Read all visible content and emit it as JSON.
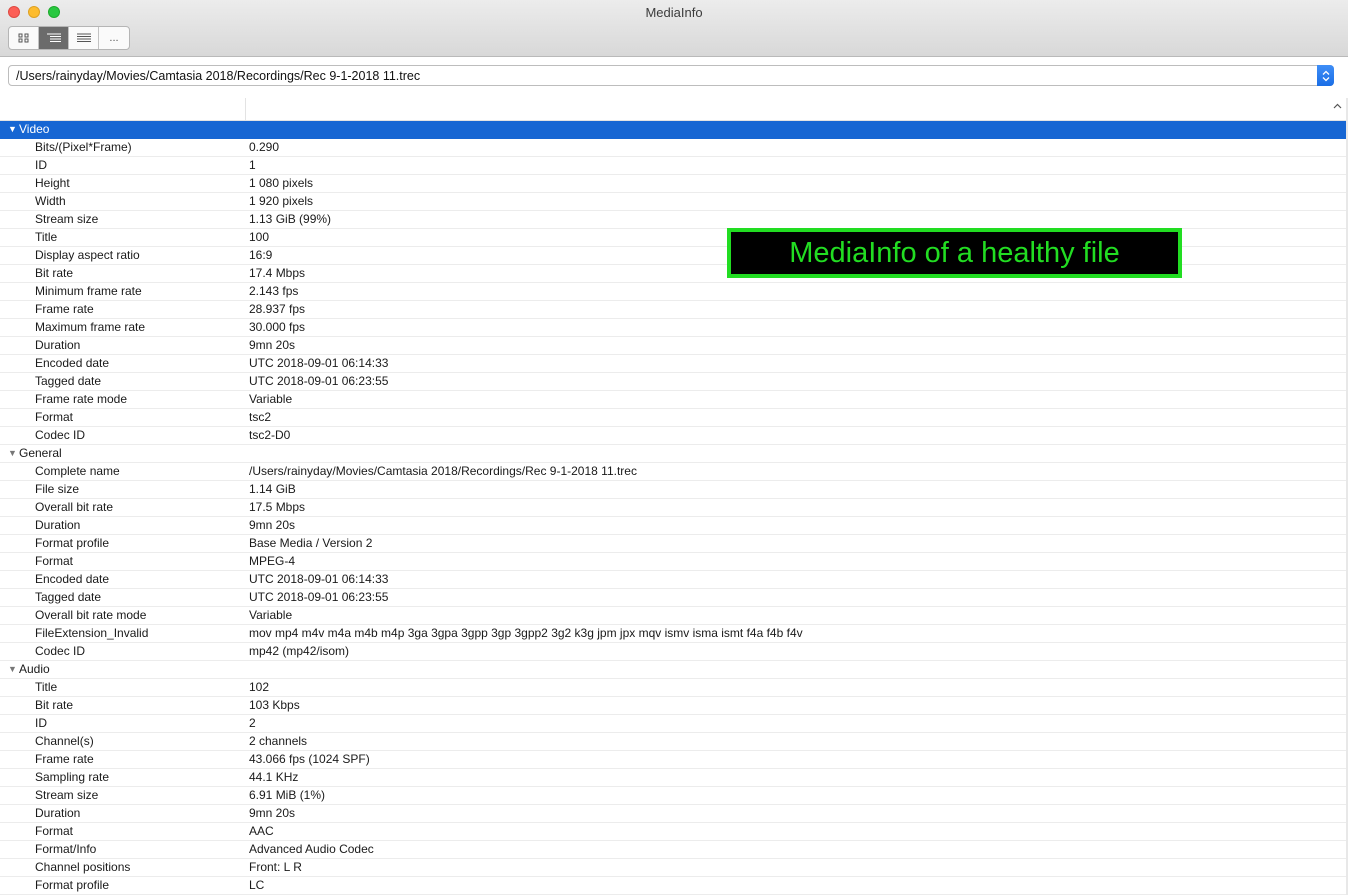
{
  "window": {
    "title": "MediaInfo"
  },
  "toolbar": {
    "view_buttons": [
      {
        "name": "grid-view-icon",
        "label": ""
      },
      {
        "name": "tree-view-icon",
        "label": ""
      },
      {
        "name": "text-view-icon",
        "label": ""
      },
      {
        "name": "more-view-button",
        "label": "..."
      }
    ],
    "active_view": "tree"
  },
  "file_path": "/Users/rainyday/Movies/Camtasia 2018/Recordings/Rec 9-1-2018 11.trec",
  "overlay": {
    "text": "MediaInfo of a healthy file",
    "color": "#22dd22"
  },
  "accent_color": "#1666d3",
  "sections": [
    {
      "name": "Video",
      "selected": true,
      "rows": [
        {
          "key": "Bits/(Pixel*Frame)",
          "value": "0.290"
        },
        {
          "key": "ID",
          "value": "1"
        },
        {
          "key": "Height",
          "value": "1 080 pixels"
        },
        {
          "key": "Width",
          "value": "1 920 pixels"
        },
        {
          "key": "Stream size",
          "value": "1.13 GiB (99%)"
        },
        {
          "key": "Title",
          "value": "100"
        },
        {
          "key": "Display aspect ratio",
          "value": "16:9"
        },
        {
          "key": "Bit rate",
          "value": "17.4 Mbps"
        },
        {
          "key": "Minimum frame rate",
          "value": "2.143 fps"
        },
        {
          "key": "Frame rate",
          "value": "28.937 fps"
        },
        {
          "key": "Maximum frame rate",
          "value": "30.000 fps"
        },
        {
          "key": "Duration",
          "value": "9mn 20s"
        },
        {
          "key": "Encoded date",
          "value": "UTC 2018-09-01 06:14:33"
        },
        {
          "key": "Tagged date",
          "value": "UTC 2018-09-01 06:23:55"
        },
        {
          "key": "Frame rate mode",
          "value": "Variable"
        },
        {
          "key": "Format",
          "value": "tsc2"
        },
        {
          "key": "Codec ID",
          "value": "tsc2-D0"
        }
      ]
    },
    {
      "name": "General",
      "selected": false,
      "rows": [
        {
          "key": "Complete name",
          "value": "/Users/rainyday/Movies/Camtasia 2018/Recordings/Rec 9-1-2018 11.trec"
        },
        {
          "key": "File size",
          "value": "1.14 GiB"
        },
        {
          "key": "Overall bit rate",
          "value": "17.5 Mbps"
        },
        {
          "key": "Duration",
          "value": "9mn 20s"
        },
        {
          "key": "Format profile",
          "value": "Base Media / Version 2"
        },
        {
          "key": "Format",
          "value": "MPEG-4"
        },
        {
          "key": "Encoded date",
          "value": "UTC 2018-09-01 06:14:33"
        },
        {
          "key": "Tagged date",
          "value": "UTC 2018-09-01 06:23:55"
        },
        {
          "key": "Overall bit rate mode",
          "value": "Variable"
        },
        {
          "key": "FileExtension_Invalid",
          "value": "mov mp4 m4v m4a m4b m4p 3ga 3gpa 3gpp 3gp 3gpp2 3g2 k3g jpm jpx mqv ismv isma ismt f4a f4b f4v"
        },
        {
          "key": "Codec ID",
          "value": "mp42 (mp42/isom)"
        }
      ]
    },
    {
      "name": "Audio",
      "selected": false,
      "rows": [
        {
          "key": "Title",
          "value": "102"
        },
        {
          "key": "Bit rate",
          "value": "103 Kbps"
        },
        {
          "key": "ID",
          "value": "2"
        },
        {
          "key": "Channel(s)",
          "value": "2 channels"
        },
        {
          "key": "Frame rate",
          "value": "43.066 fps (1024 SPF)"
        },
        {
          "key": "Sampling rate",
          "value": "44.1 KHz"
        },
        {
          "key": "Stream size",
          "value": "6.91 MiB (1%)"
        },
        {
          "key": "Duration",
          "value": "9mn 20s"
        },
        {
          "key": "Format",
          "value": "AAC"
        },
        {
          "key": "Format/Info",
          "value": "Advanced Audio Codec"
        },
        {
          "key": "Channel positions",
          "value": "Front: L R"
        },
        {
          "key": "Format profile",
          "value": "LC"
        }
      ]
    }
  ]
}
